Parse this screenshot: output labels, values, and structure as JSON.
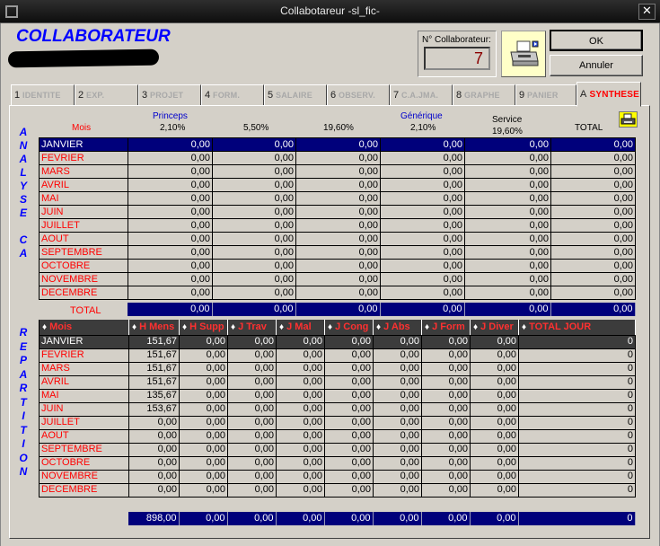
{
  "window": {
    "title": "Collabotareur -sl_fic-",
    "close_glyph": "✕"
  },
  "header": {
    "title": "COLLABORATEUR",
    "collab_label": "N° Collaborateur:",
    "collab_value": "7",
    "ok_label": "OK",
    "cancel_label": "Annuler"
  },
  "tabs": [
    {
      "num": "1",
      "label": "IDENTITE"
    },
    {
      "num": "2",
      "label": "EXP."
    },
    {
      "num": "3",
      "label": "PROJET"
    },
    {
      "num": "4",
      "label": "FORM."
    },
    {
      "num": "5",
      "label": "SALAIRE"
    },
    {
      "num": "6",
      "label": "OBSERV."
    },
    {
      "num": "7",
      "label": "C.A.JMA."
    },
    {
      "num": "8",
      "label": "GRAPHE"
    },
    {
      "num": "9",
      "label": "PANIER"
    },
    {
      "num": "A",
      "label": "SYNTHESE"
    }
  ],
  "analyse": {
    "side_label": [
      "A",
      "N",
      "A",
      "L",
      "Y",
      "S",
      "E",
      "",
      "C",
      "A"
    ],
    "headers": {
      "mois": "Mois",
      "princeps": "Princeps",
      "generique": "Générique",
      "service": "Service",
      "total": "TOTAL",
      "rates": [
        "2,10%",
        "5,50%",
        "19,60%",
        "2,10%",
        "19,60%"
      ]
    },
    "rows": [
      [
        "JANVIER",
        "0,00",
        "0,00",
        "0,00",
        "0,00",
        "0,00",
        "0,00"
      ],
      [
        "FEVRIER",
        "0,00",
        "0,00",
        "0,00",
        "0,00",
        "0,00",
        "0,00"
      ],
      [
        "MARS",
        "0,00",
        "0,00",
        "0,00",
        "0,00",
        "0,00",
        "0,00"
      ],
      [
        "AVRIL",
        "0,00",
        "0,00",
        "0,00",
        "0,00",
        "0,00",
        "0,00"
      ],
      [
        "MAI",
        "0,00",
        "0,00",
        "0,00",
        "0,00",
        "0,00",
        "0,00"
      ],
      [
        "JUIN",
        "0,00",
        "0,00",
        "0,00",
        "0,00",
        "0,00",
        "0,00"
      ],
      [
        "JUILLET",
        "0,00",
        "0,00",
        "0,00",
        "0,00",
        "0,00",
        "0,00"
      ],
      [
        "AOUT",
        "0,00",
        "0,00",
        "0,00",
        "0,00",
        "0,00",
        "0,00"
      ],
      [
        "SEPTEMBRE",
        "0,00",
        "0,00",
        "0,00",
        "0,00",
        "0,00",
        "0,00"
      ],
      [
        "OCTOBRE",
        "0,00",
        "0,00",
        "0,00",
        "0,00",
        "0,00",
        "0,00"
      ],
      [
        "NOVEMBRE",
        "0,00",
        "0,00",
        "0,00",
        "0,00",
        "0,00",
        "0,00"
      ],
      [
        "DECEMBRE",
        "0,00",
        "0,00",
        "0,00",
        "0,00",
        "0,00",
        "0,00"
      ]
    ],
    "total_label": "TOTAL",
    "totals": [
      "0,00",
      "0,00",
      "0,00",
      "0,00",
      "0,00",
      "0,00"
    ]
  },
  "repartition": {
    "side_label": [
      "R",
      "E",
      "P",
      "A",
      "R",
      "T",
      "I",
      "T",
      "I",
      "O",
      "N"
    ],
    "columns": [
      "Mois",
      "H Mens",
      "H Supp",
      "J Trav",
      "J Mal",
      "J Cong",
      "J Abs",
      "J Form",
      "J Diver",
      "TOTAL JOUR"
    ],
    "rows": [
      [
        "JANVIER",
        "151,67",
        "0,00",
        "0,00",
        "0,00",
        "0,00",
        "0,00",
        "0,00",
        "0,00",
        "0"
      ],
      [
        "FEVRIER",
        "151,67",
        "0,00",
        "0,00",
        "0,00",
        "0,00",
        "0,00",
        "0,00",
        "0,00",
        "0"
      ],
      [
        "MARS",
        "151,67",
        "0,00",
        "0,00",
        "0,00",
        "0,00",
        "0,00",
        "0,00",
        "0,00",
        "0"
      ],
      [
        "AVRIL",
        "151,67",
        "0,00",
        "0,00",
        "0,00",
        "0,00",
        "0,00",
        "0,00",
        "0,00",
        "0"
      ],
      [
        "MAI",
        "135,67",
        "0,00",
        "0,00",
        "0,00",
        "0,00",
        "0,00",
        "0,00",
        "0,00",
        "0"
      ],
      [
        "JUIN",
        "153,67",
        "0,00",
        "0,00",
        "0,00",
        "0,00",
        "0,00",
        "0,00",
        "0,00",
        "0"
      ],
      [
        "JUILLET",
        "0,00",
        "0,00",
        "0,00",
        "0,00",
        "0,00",
        "0,00",
        "0,00",
        "0,00",
        "0"
      ],
      [
        "AOUT",
        "0,00",
        "0,00",
        "0,00",
        "0,00",
        "0,00",
        "0,00",
        "0,00",
        "0,00",
        "0"
      ],
      [
        "SEPTEMBRE",
        "0,00",
        "0,00",
        "0,00",
        "0,00",
        "0,00",
        "0,00",
        "0,00",
        "0,00",
        "0"
      ],
      [
        "OCTOBRE",
        "0,00",
        "0,00",
        "0,00",
        "0,00",
        "0,00",
        "0,00",
        "0,00",
        "0,00",
        "0"
      ],
      [
        "NOVEMBRE",
        "0,00",
        "0,00",
        "0,00",
        "0,00",
        "0,00",
        "0,00",
        "0,00",
        "0,00",
        "0"
      ],
      [
        "DECEMBRE",
        "0,00",
        "0,00",
        "0,00",
        "0,00",
        "0,00",
        "0,00",
        "0,00",
        "0,00",
        "0"
      ]
    ],
    "totals": [
      "898,00",
      "0,00",
      "0,00",
      "0,00",
      "0,00",
      "0,00",
      "0,00",
      "0,00",
      "0"
    ]
  },
  "colors": {
    "accent_blue": "#0000ff",
    "selection": "#00007b",
    "label_red": "#ff0000",
    "printer_bg": "#ffff00"
  }
}
